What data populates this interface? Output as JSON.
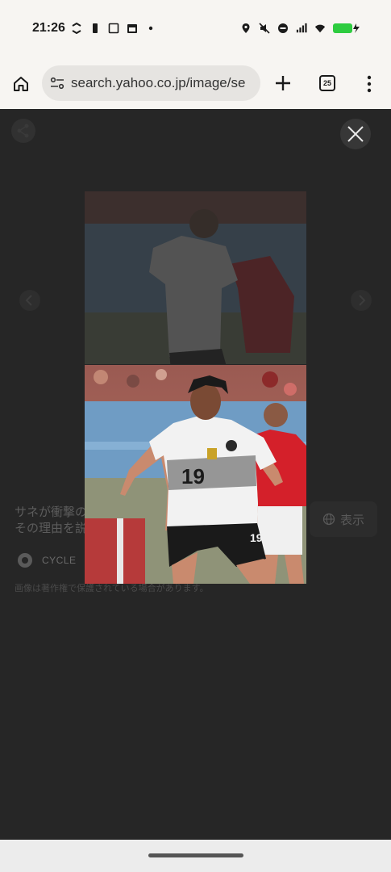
{
  "status_bar": {
    "time": "21:26",
    "left_icons": [
      "data-saver-icon",
      "battery-saver-icon",
      "screen-icon",
      "calendar-icon",
      "dot-icon"
    ],
    "right_icons": [
      "location-icon",
      "mute-icon",
      "dnd-icon",
      "signal-icon",
      "wifi-icon",
      "battery-charging-icon"
    ],
    "battery_color": "#2ecc40"
  },
  "browser": {
    "url": "search.yahoo.co.jp/image/se",
    "tab_count": "25",
    "icons": [
      "home-icon",
      "site-settings-icon",
      "plus-icon",
      "tab-switcher-icon",
      "more-vert-icon"
    ]
  },
  "viewer": {
    "caption_line1": "サネが衝撃の",
    "caption_line2": "その理由を説",
    "source_name": "CYCLE",
    "view_button_label": "表示",
    "copyright_note": "画像は著作権で保護されている場合があります。",
    "icons": [
      "share-icon",
      "close-icon",
      "chevron-left-icon",
      "chevron-right-icon",
      "globe-icon"
    ]
  },
  "photo": {
    "jersey_number": "19",
    "shorts_number": "19",
    "colors": {
      "jersey": "#f2f2f2",
      "shorts": "#1a1a1a",
      "opponent": "#d4202a",
      "background_blue": "#6f9cc4"
    }
  }
}
